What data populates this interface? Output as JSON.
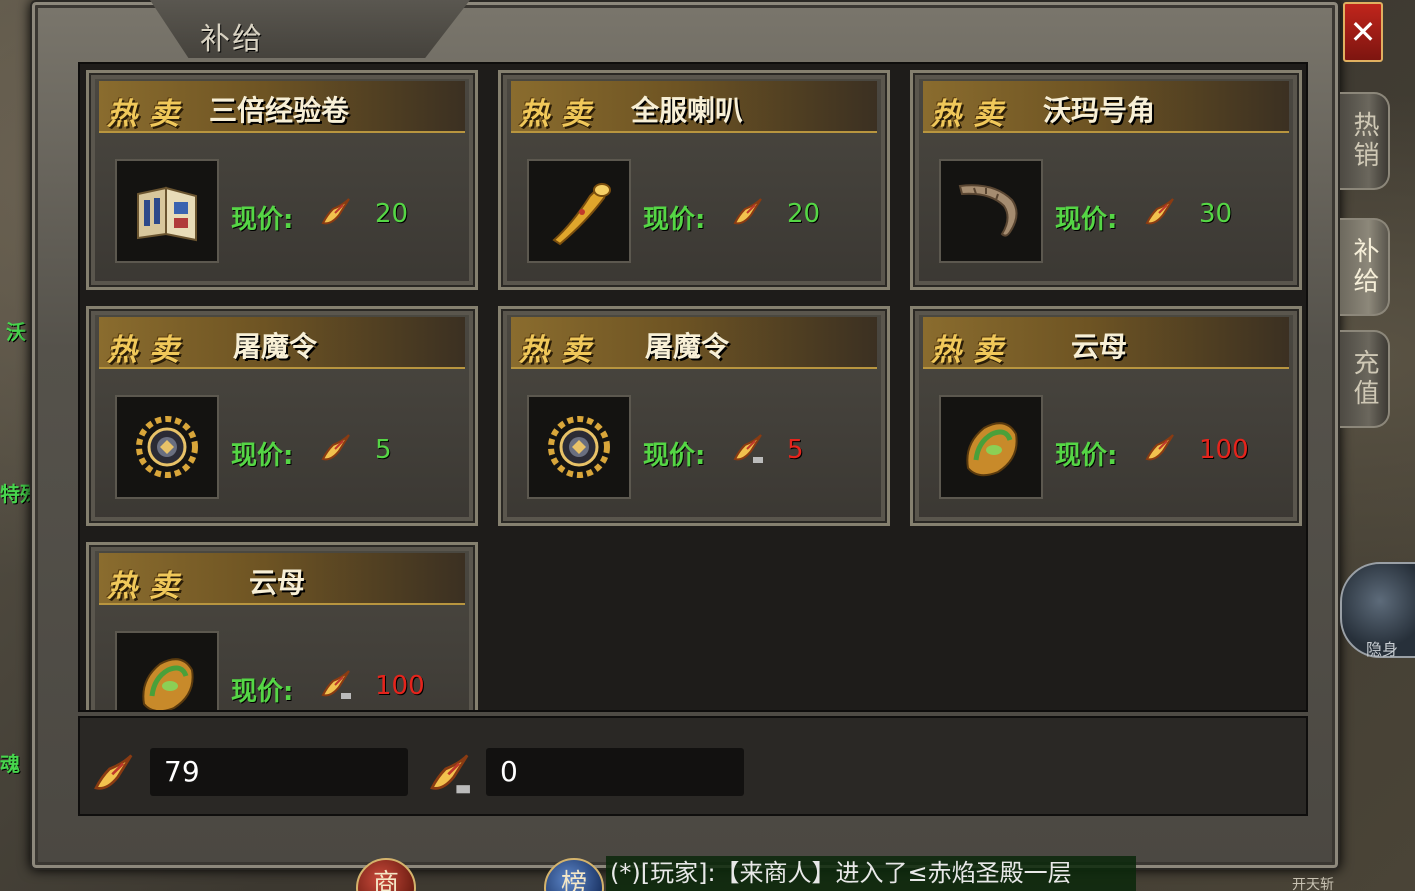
{
  "window": {
    "title": "补给",
    "close_icon": "close-icon",
    "close_label": "✕"
  },
  "side_tabs": [
    {
      "label": "热销",
      "active": false
    },
    {
      "label": "补给",
      "active": true
    },
    {
      "label": "充值",
      "active": false
    }
  ],
  "cards": [
    {
      "badge": "热卖",
      "name": "三倍经验卷",
      "price_label": "现价:",
      "price": "20",
      "price_color": "green",
      "icon": "scroll-book-icon"
    },
    {
      "badge": "热卖",
      "name": "全服喇叭",
      "price_label": "现价:",
      "price": "20",
      "price_color": "green",
      "icon": "horn-icon"
    },
    {
      "badge": "热卖",
      "name": "沃玛号角",
      "price_label": "现价:",
      "price": "30",
      "price_color": "green",
      "icon": "curved-horn-icon"
    },
    {
      "badge": "热卖",
      "name": "屠魔令",
      "price_label": "现价:",
      "price": "5",
      "price_color": "green",
      "icon": "demon-token-icon"
    },
    {
      "badge": "热卖",
      "name": "屠魔令",
      "price_label": "现价:",
      "price": "5",
      "price_color": "red",
      "icon": "demon-token-icon"
    },
    {
      "badge": "热卖",
      "name": "云母",
      "price_label": "现价:",
      "price": "100",
      "price_color": "red",
      "icon": "mica-stone-icon"
    },
    {
      "badge": "热卖",
      "name": "云母",
      "price_label": "现价:",
      "price": "100",
      "price_color": "red",
      "icon": "mica-stone-icon"
    }
  ],
  "balances": [
    {
      "icon": "currency-icon",
      "value": "79"
    },
    {
      "icon": "bound-currency-icon",
      "value": "0"
    }
  ],
  "chat": {
    "message": "(*)[玩家]:【来商人】进入了≤赤焰圣殿一层"
  },
  "bottom_buttons": [
    {
      "label": "商"
    },
    {
      "label": "榜"
    }
  ],
  "left_labels": [
    "沃",
    "特殊",
    "魂"
  ],
  "right_orb_label": "隐身",
  "bottom_right_label": "开天斩",
  "colors": {
    "price_green": "#55d645",
    "price_red": "#e5241c",
    "badge_gold": "#f0c85a"
  }
}
